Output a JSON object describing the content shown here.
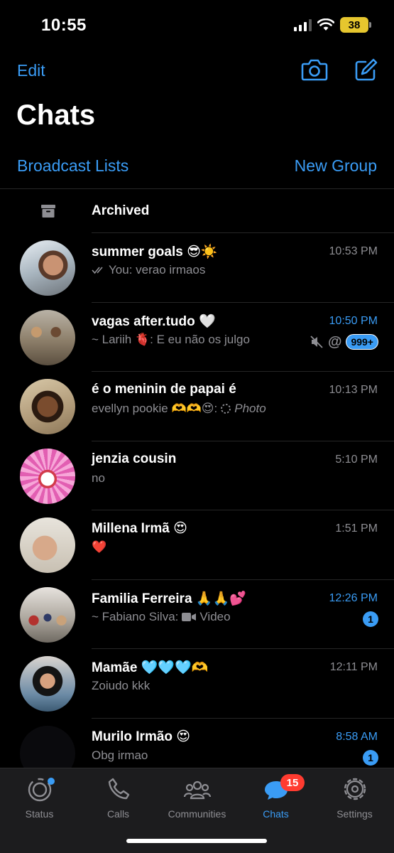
{
  "status_bar": {
    "time": "10:55",
    "battery": "38"
  },
  "header": {
    "edit_label": "Edit",
    "title": "Chats",
    "broadcast_label": "Broadcast Lists",
    "new_group_label": "New Group"
  },
  "archived": {
    "label": "Archived"
  },
  "chats": [
    {
      "name": "summer goals 😎☀️",
      "time": "10:53 PM",
      "time_unread": false,
      "preview": "You: verao irmaos",
      "preview_icon": "double-check-icon"
    },
    {
      "name": "vagas after.tudo 🤍",
      "time": "10:50 PM",
      "time_unread": true,
      "preview": "~ Lariih 🫀: E eu não os julgo",
      "badge": "999+",
      "muted": true,
      "mention": "@"
    },
    {
      "name": "é o meninin de papai é",
      "time": "10:13 PM",
      "time_unread": false,
      "preview": "evellyn pookie 🫶🫶😍:",
      "preview_suffix": "Photo"
    },
    {
      "name": "jenzia cousin",
      "time": "5:10 PM",
      "time_unread": false,
      "preview": "no"
    },
    {
      "name": "Millena Irmã 😍",
      "time": "1:51 PM",
      "time_unread": false,
      "preview": "❤️"
    },
    {
      "name": "Familia Ferreira 🙏🙏💕",
      "time": "12:26 PM",
      "time_unread": true,
      "preview": "~ Fabiano Silva:",
      "preview_suffix": "Video",
      "badge": "1"
    },
    {
      "name": "Mamãe 🩵🩵🩵🫶",
      "time": "12:11 PM",
      "time_unread": false,
      "preview": "Zoiudo kkk"
    },
    {
      "name": "Murilo Irmão 😍",
      "time": "8:58 AM",
      "time_unread": true,
      "preview": "Obg irmao",
      "badge": "1"
    }
  ],
  "tabs": [
    {
      "label": "Status",
      "icon": "status-ring-icon"
    },
    {
      "label": "Calls",
      "icon": "phone-icon"
    },
    {
      "label": "Communities",
      "icon": "communities-icon"
    },
    {
      "label": "Chats",
      "icon": "chat-bubbles-icon",
      "badge": "15",
      "active": true
    },
    {
      "label": "Settings",
      "icon": "gear-icon"
    }
  ],
  "colors": {
    "accent": "#3a9cf5",
    "badge_red": "#ff3b30",
    "muted_text": "#8e8e93"
  }
}
